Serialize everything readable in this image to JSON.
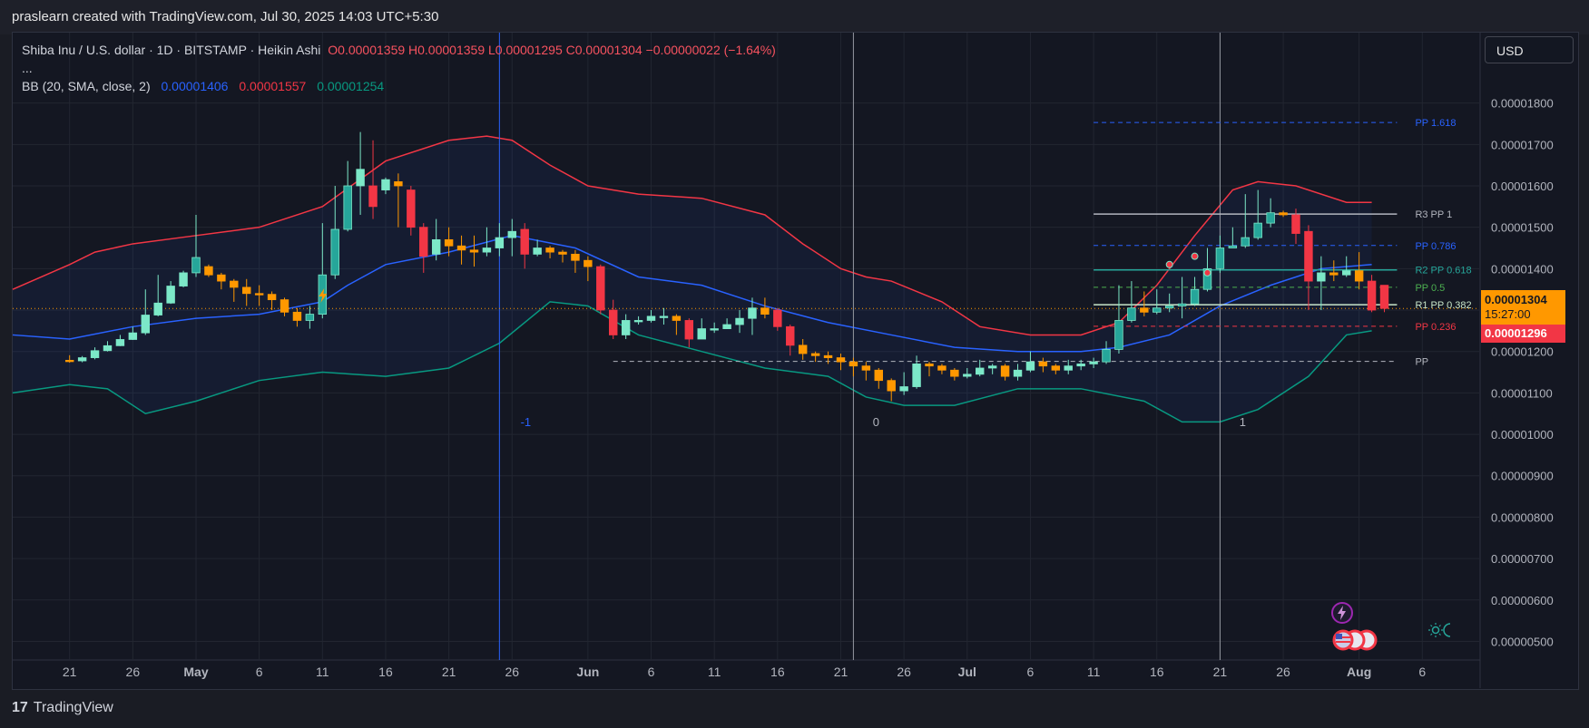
{
  "header": {
    "attribution": "praslearn created with TradingView.com, Jul 30, 2025 14:03 UTC+5:30"
  },
  "legend": {
    "symbol": "Shiba Inu / U.S. dollar · 1D · BITSTAMP · Heikin Ashi",
    "ohlc": "O0.00001359 H0.00001359 L0.00001295 C0.00001304 −0.00000022 (−1.64%)",
    "more": "...",
    "bb_label": "BB (20, SMA, close, 2)",
    "bb_basis": "0.00001406",
    "bb_upper": "0.00001557",
    "bb_lower": "0.00001254"
  },
  "currency_button": "USD",
  "price_tags": {
    "last": "0.00001304",
    "countdown": "15:27:00",
    "pre": "0.00001296"
  },
  "footer": {
    "brand": "TradingView",
    "logo_glyph": "17"
  },
  "colors": {
    "up": "#26a69a",
    "up_light": "#7ce8c8",
    "down": "#f23645",
    "down_orange": "#ff9800",
    "bb_upper": "#f23645",
    "bb_basis": "#2962ff",
    "bb_lower": "#089981"
  },
  "chart_data": {
    "type": "candlestick",
    "y_tick_labels": [
      "0.00001800",
      "0.00001700",
      "0.00001600",
      "0.00001500",
      "0.00001400",
      "0.00001300",
      "0.00001200",
      "0.00001100",
      "0.00001000",
      "0.00000900",
      "0.00000800",
      "0.00000700",
      "0.00000600",
      "0.00000500"
    ],
    "y_ticks": [
      1.8e-05,
      1.7e-05,
      1.6e-05,
      1.5e-05,
      1.4e-05,
      1.3e-05,
      1.2e-05,
      1.1e-05,
      1e-05,
      9e-06,
      8e-06,
      7e-06,
      6e-06,
      5e-06
    ],
    "ylim": [
      4.55e-06,
      1.97e-05
    ],
    "x_tick_labels": [
      "21",
      "26",
      "May",
      "6",
      "11",
      "16",
      "21",
      "26",
      "Jun",
      "6",
      "11",
      "16",
      "21",
      "26",
      "Jul",
      "6",
      "11",
      "16",
      "21",
      "26",
      "Aug",
      "6"
    ],
    "x_tick_days": [
      0,
      5,
      10,
      15,
      20,
      25,
      30,
      35,
      41,
      46,
      51,
      56,
      61,
      66,
      71,
      76,
      81,
      86,
      91,
      96,
      102,
      107
    ],
    "x_range_days": [
      -4.5,
      111.5
    ],
    "vertical_lines": [
      {
        "day": 34,
        "label": "-1"
      },
      {
        "day": 62,
        "label": "0"
      },
      {
        "day": 91,
        "label": "1"
      }
    ],
    "candles": [
      [
        1.1788,
        1.1774,
        1.191,
        1.173
      ],
      [
        1.1774,
        1.185,
        1.189,
        1.174
      ],
      [
        1.185,
        1.202,
        1.21,
        1.181
      ],
      [
        1.202,
        1.214,
        1.225,
        1.2
      ],
      [
        1.214,
        1.229,
        1.24,
        1.213
      ],
      [
        1.229,
        1.245,
        1.26,
        1.228
      ],
      [
        1.245,
        1.288,
        1.35,
        1.24
      ],
      [
        1.288,
        1.317,
        1.385,
        1.285
      ],
      [
        1.317,
        1.358,
        1.37,
        1.315
      ],
      [
        1.358,
        1.39,
        1.395,
        1.355
      ],
      [
        1.39,
        1.427,
        1.53,
        1.38
      ],
      [
        1.405,
        1.385,
        1.41,
        1.38
      ],
      [
        1.385,
        1.37,
        1.39,
        1.35
      ],
      [
        1.37,
        1.355,
        1.375,
        1.32
      ],
      [
        1.355,
        1.34,
        1.375,
        1.31
      ],
      [
        1.34,
        1.338,
        1.36,
        1.31
      ],
      [
        1.338,
        1.325,
        1.345,
        1.3
      ],
      [
        1.325,
        1.295,
        1.33,
        1.285
      ],
      [
        1.295,
        1.275,
        1.305,
        1.26
      ],
      [
        1.275,
        1.29,
        1.31,
        1.255
      ],
      [
        1.29,
        1.385,
        1.51,
        1.28
      ],
      [
        1.385,
        1.495,
        1.6,
        1.375
      ],
      [
        1.495,
        1.6,
        1.66,
        1.49
      ],
      [
        1.6,
        1.64,
        1.73,
        1.53
      ],
      [
        1.6,
        1.55,
        1.71,
        1.52
      ],
      [
        1.59,
        1.615,
        1.62,
        1.58
      ],
      [
        1.61,
        1.6,
        1.63,
        1.5
      ],
      [
        1.59,
        1.5,
        1.6,
        1.48
      ],
      [
        1.5,
        1.43,
        1.51,
        1.39
      ],
      [
        1.435,
        1.47,
        1.52,
        1.42
      ],
      [
        1.47,
        1.455,
        1.5,
        1.43
      ],
      [
        1.455,
        1.445,
        1.48,
        1.41
      ],
      [
        1.445,
        1.44,
        1.48,
        1.405
      ],
      [
        1.44,
        1.45,
        1.5,
        1.43
      ],
      [
        1.45,
        1.475,
        1.51,
        1.43
      ],
      [
        1.475,
        1.49,
        1.52,
        1.43
      ],
      [
        1.495,
        1.435,
        1.51,
        1.4
      ],
      [
        1.435,
        1.45,
        1.47,
        1.43
      ],
      [
        1.45,
        1.44,
        1.455,
        1.425
      ],
      [
        1.44,
        1.435,
        1.445,
        1.415
      ],
      [
        1.435,
        1.42,
        1.445,
        1.39
      ],
      [
        1.42,
        1.405,
        1.43,
        1.37
      ],
      [
        1.405,
        1.3,
        1.41,
        1.29
      ],
      [
        1.3,
        1.24,
        1.325,
        1.23
      ],
      [
        1.24,
        1.275,
        1.29,
        1.23
      ],
      [
        1.275,
        1.275,
        1.285,
        1.265
      ],
      [
        1.275,
        1.285,
        1.3,
        1.27
      ],
      [
        1.285,
        1.285,
        1.305,
        1.265
      ],
      [
        1.285,
        1.275,
        1.29,
        1.24
      ],
      [
        1.275,
        1.23,
        1.28,
        1.21
      ],
      [
        1.23,
        1.255,
        1.28,
        1.24
      ],
      [
        1.255,
        1.255,
        1.27,
        1.245
      ],
      [
        1.255,
        1.265,
        1.28,
        1.255
      ],
      [
        1.265,
        1.28,
        1.3,
        1.245
      ],
      [
        1.28,
        1.305,
        1.33,
        1.24
      ],
      [
        1.305,
        1.29,
        1.33,
        1.28
      ],
      [
        1.3,
        1.26,
        1.305,
        1.25
      ],
      [
        1.26,
        1.215,
        1.265,
        1.19
      ],
      [
        1.215,
        1.195,
        1.23,
        1.18
      ],
      [
        1.195,
        1.19,
        1.2,
        1.175
      ],
      [
        1.19,
        1.185,
        1.2,
        1.17
      ],
      [
        1.185,
        1.175,
        1.195,
        1.155
      ],
      [
        1.175,
        1.165,
        1.185,
        1.14
      ],
      [
        1.165,
        1.155,
        1.175,
        1.13
      ],
      [
        1.155,
        1.13,
        1.16,
        1.11
      ],
      [
        1.13,
        1.105,
        1.135,
        1.08
      ],
      [
        1.105,
        1.115,
        1.15,
        1.095
      ],
      [
        1.115,
        1.17,
        1.19,
        1.11
      ],
      [
        1.17,
        1.165,
        1.175,
        1.14
      ],
      [
        1.165,
        1.155,
        1.17,
        1.145
      ],
      [
        1.155,
        1.14,
        1.16,
        1.13
      ],
      [
        1.14,
        1.145,
        1.16,
        1.135
      ],
      [
        1.145,
        1.16,
        1.18,
        1.14
      ],
      [
        1.16,
        1.165,
        1.17,
        1.145
      ],
      [
        1.165,
        1.14,
        1.17,
        1.13
      ],
      [
        1.14,
        1.155,
        1.17,
        1.13
      ],
      [
        1.155,
        1.175,
        1.2,
        1.15
      ],
      [
        1.175,
        1.165,
        1.185,
        1.15
      ],
      [
        1.165,
        1.155,
        1.17,
        1.145
      ],
      [
        1.155,
        1.165,
        1.18,
        1.145
      ],
      [
        1.165,
        1.17,
        1.18,
        1.155
      ],
      [
        1.17,
        1.175,
        1.185,
        1.16
      ],
      [
        1.175,
        1.205,
        1.225,
        1.17
      ],
      [
        1.205,
        1.275,
        1.36,
        1.195
      ],
      [
        1.275,
        1.305,
        1.37,
        1.27
      ],
      [
        1.305,
        1.295,
        1.345,
        1.285
      ],
      [
        1.295,
        1.305,
        1.35,
        1.29
      ],
      [
        1.305,
        1.31,
        1.34,
        1.295
      ],
      [
        1.31,
        1.315,
        1.38,
        1.28
      ],
      [
        1.315,
        1.35,
        1.38,
        1.31
      ],
      [
        1.35,
        1.4,
        1.45,
        1.345
      ],
      [
        1.4,
        1.45,
        1.48,
        1.39
      ],
      [
        1.45,
        1.455,
        1.5,
        1.45
      ],
      [
        1.455,
        1.475,
        1.58,
        1.45
      ],
      [
        1.475,
        1.51,
        1.59,
        1.47
      ],
      [
        1.51,
        1.535,
        1.57,
        1.5
      ],
      [
        1.535,
        1.53,
        1.54,
        1.525
      ],
      [
        1.53,
        1.485,
        1.545,
        1.46
      ],
      [
        1.49,
        1.37,
        1.505,
        1.3
      ],
      [
        1.37,
        1.39,
        1.43,
        1.3
      ],
      [
        1.39,
        1.385,
        1.42,
        1.37
      ],
      [
        1.385,
        1.395,
        1.43,
        1.38
      ],
      [
        1.395,
        1.37,
        1.44,
        1.35
      ],
      [
        1.37,
        1.3,
        1.385,
        1.295
      ],
      [
        1.36,
        1.304,
        1.36,
        1.295
      ]
    ],
    "bb_upper": [
      [
        -4.5,
        1.35
      ],
      [
        0,
        1.41
      ],
      [
        2,
        1.44
      ],
      [
        5,
        1.46
      ],
      [
        10,
        1.48
      ],
      [
        15,
        1.5
      ],
      [
        20,
        1.55
      ],
      [
        25,
        1.66
      ],
      [
        30,
        1.71
      ],
      [
        33,
        1.72
      ],
      [
        35,
        1.71
      ],
      [
        38,
        1.65
      ],
      [
        41,
        1.6
      ],
      [
        45,
        1.58
      ],
      [
        50,
        1.57
      ],
      [
        55,
        1.53
      ],
      [
        58,
        1.46
      ],
      [
        61,
        1.4
      ],
      [
        63,
        1.38
      ],
      [
        65,
        1.37
      ],
      [
        69,
        1.32
      ],
      [
        72,
        1.26
      ],
      [
        76,
        1.24
      ],
      [
        80,
        1.24
      ],
      [
        83,
        1.27
      ],
      [
        86,
        1.36
      ],
      [
        89,
        1.48
      ],
      [
        92,
        1.59
      ],
      [
        94,
        1.61
      ],
      [
        97,
        1.6
      ],
      [
        101,
        1.56
      ],
      [
        103,
        1.56
      ]
    ],
    "bb_basis": [
      [
        -4.5,
        1.24
      ],
      [
        0,
        1.23
      ],
      [
        5,
        1.26
      ],
      [
        10,
        1.28
      ],
      [
        15,
        1.29
      ],
      [
        20,
        1.32
      ],
      [
        22,
        1.36
      ],
      [
        25,
        1.41
      ],
      [
        30,
        1.44
      ],
      [
        35,
        1.48
      ],
      [
        40,
        1.45
      ],
      [
        45,
        1.38
      ],
      [
        50,
        1.36
      ],
      [
        55,
        1.31
      ],
      [
        60,
        1.27
      ],
      [
        65,
        1.24
      ],
      [
        70,
        1.21
      ],
      [
        75,
        1.2
      ],
      [
        80,
        1.2
      ],
      [
        83,
        1.21
      ],
      [
        87,
        1.24
      ],
      [
        91,
        1.31
      ],
      [
        95,
        1.36
      ],
      [
        99,
        1.4
      ],
      [
        103,
        1.41
      ]
    ],
    "bb_lower": [
      [
        -4.5,
        1.1
      ],
      [
        0,
        1.12
      ],
      [
        3,
        1.11
      ],
      [
        6,
        1.05
      ],
      [
        10,
        1.08
      ],
      [
        15,
        1.13
      ],
      [
        20,
        1.15
      ],
      [
        25,
        1.14
      ],
      [
        30,
        1.16
      ],
      [
        34,
        1.22
      ],
      [
        38,
        1.32
      ],
      [
        41,
        1.31
      ],
      [
        45,
        1.24
      ],
      [
        50,
        1.2
      ],
      [
        55,
        1.16
      ],
      [
        60,
        1.14
      ],
      [
        63,
        1.09
      ],
      [
        66,
        1.07
      ],
      [
        70,
        1.07
      ],
      [
        75,
        1.11
      ],
      [
        80,
        1.11
      ],
      [
        85,
        1.08
      ],
      [
        88,
        1.03
      ],
      [
        91,
        1.03
      ],
      [
        94,
        1.06
      ],
      [
        98,
        1.14
      ],
      [
        101,
        1.24
      ],
      [
        103,
        1.25
      ]
    ],
    "pivot_levels": [
      {
        "label": "PP 1.618",
        "value": 1.753e-05,
        "color": "#2962ff",
        "dashed": true
      },
      {
        "label": "R3 PP 1",
        "value": 1.532e-05,
        "color": "#b2b5be",
        "dashed": false
      },
      {
        "label": "PP 0.786",
        "value": 1.456e-05,
        "color": "#2962ff",
        "dashed": true
      },
      {
        "label": "R2 PP 0.618",
        "value": 1.397e-05,
        "color": "#26a69a",
        "dashed": false
      },
      {
        "label": "PP 0.5",
        "value": 1.355e-05,
        "color": "#4caf50",
        "dashed": true
      },
      {
        "label": "R1 PP 0.382",
        "value": 1.313e-05,
        "color": "#c8e6c9",
        "dashed": false
      },
      {
        "label": "PP 0.236",
        "value": 1.261e-05,
        "color": "#f23645",
        "dashed": true
      },
      {
        "label": "PP",
        "value": 1.176e-05,
        "color": "#b2b5be",
        "dashed": true
      }
    ],
    "pivot_day_range": [
      81,
      105
    ],
    "pp_base_day_range": [
      43,
      81
    ],
    "last_price": 1.304e-05,
    "grid": true
  }
}
